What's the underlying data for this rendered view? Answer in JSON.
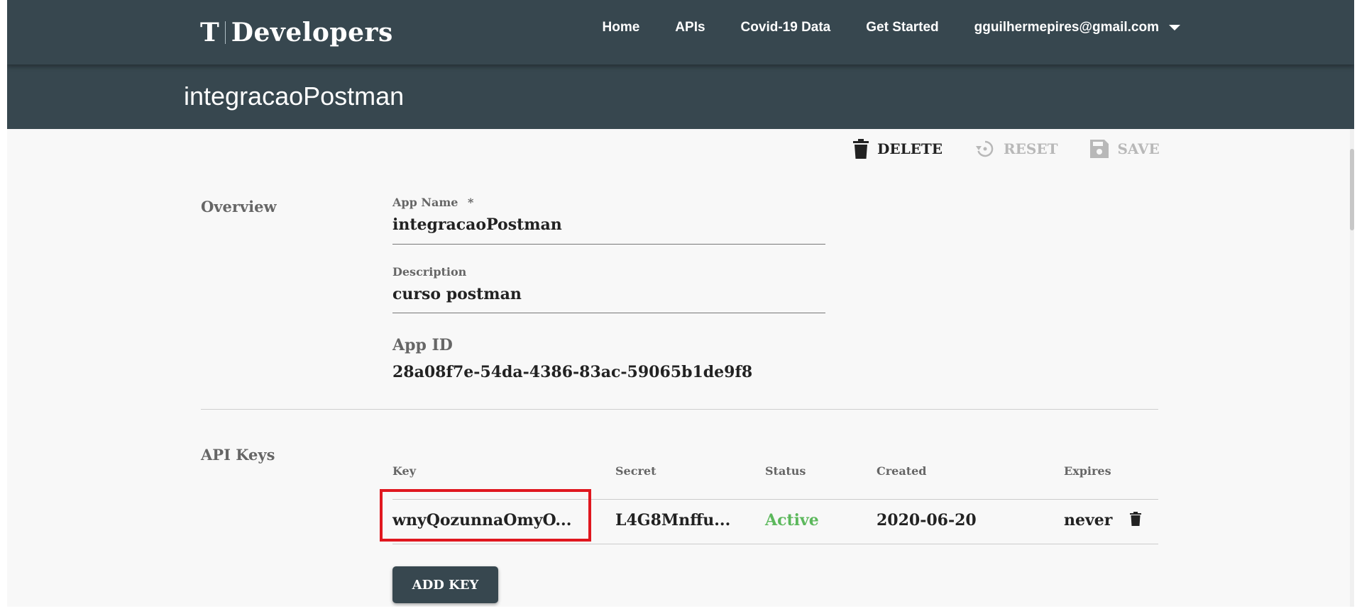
{
  "nav": {
    "logo_mark": "T",
    "logo_text": "Developers",
    "links": [
      "Home",
      "APIs",
      "Covid-19 Data",
      "Get Started"
    ],
    "user_email": "gguilhermepires@gmail.com"
  },
  "app": {
    "title": "integracaoPostman"
  },
  "toolbar": {
    "delete_label": "DELETE",
    "reset_label": "RESET",
    "save_label": "SAVE"
  },
  "overview": {
    "section_label": "Overview",
    "app_name_label": "App Name",
    "required_mark": "*",
    "app_name_value": "integracaoPostman",
    "description_label": "Description",
    "description_value": "curso postman",
    "app_id_label": "App ID",
    "app_id_value": "28a08f7e-54da-4386-83ac-59065b1de9f8"
  },
  "api_keys": {
    "section_label": "API Keys",
    "columns": [
      "Key",
      "Secret",
      "Status",
      "Created",
      "Expires"
    ],
    "rows": [
      {
        "key": "wnyQozunnaOmyO...",
        "secret": "L4G8Mnffu...",
        "status": "Active",
        "created": "2020-06-20",
        "expires": "never"
      }
    ],
    "add_key_label": "ADD KEY"
  },
  "colors": {
    "header_bg": "#37474f",
    "page_bg": "#f8f8f8",
    "status_active": "#5cb85c",
    "highlight": "#e0171f"
  }
}
